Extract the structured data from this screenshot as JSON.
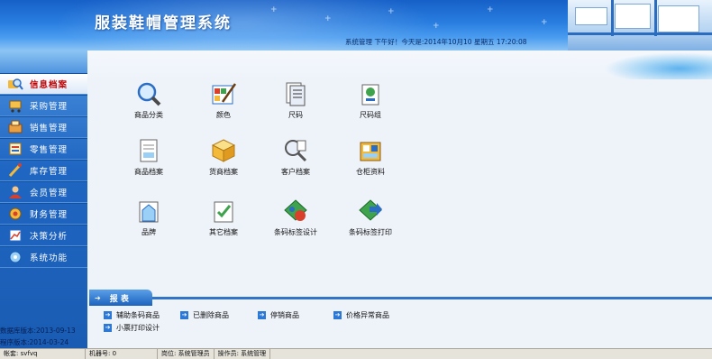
{
  "header": {
    "title": "服装鞋帽管理系统",
    "status": "系统管理  下午好！今天是:2014年10月10  星期五    17:20:08"
  },
  "sidebar": {
    "items": [
      {
        "label": "信息档案",
        "icon": "folder-search-icon",
        "active": true
      },
      {
        "label": "采购管理",
        "icon": "cart-icon",
        "active": false
      },
      {
        "label": "销售管理",
        "icon": "sale-icon",
        "active": false
      },
      {
        "label": "零售管理",
        "icon": "retail-icon",
        "active": false
      },
      {
        "label": "库存管理",
        "icon": "stock-icon",
        "active": false
      },
      {
        "label": "会员管理",
        "icon": "member-icon",
        "active": false
      },
      {
        "label": "财务管理",
        "icon": "finance-icon",
        "active": false
      },
      {
        "label": "决策分析",
        "icon": "analysis-icon",
        "active": false
      },
      {
        "label": "系统功能",
        "icon": "system-icon",
        "active": false
      }
    ],
    "db_version": "数据库版本:2013-09-13",
    "app_version": "程序版本:2014-03-24"
  },
  "tiles": [
    {
      "label": "商品分类",
      "icon": "magnifier-icon"
    },
    {
      "label": "颜色",
      "icon": "palette-icon"
    },
    {
      "label": "尺码",
      "icon": "ruler-doc-icon"
    },
    {
      "label": "尺码组",
      "icon": "size-group-icon"
    },
    {
      "label": "商品档案",
      "icon": "product-file-icon"
    },
    {
      "label": "货商档案",
      "icon": "supplier-box-icon"
    },
    {
      "label": "客户档案",
      "icon": "customer-search-icon"
    },
    {
      "label": "仓柜资料",
      "icon": "warehouse-icon"
    },
    {
      "label": "品牌",
      "icon": "brand-icon"
    },
    {
      "label": "其它档案",
      "icon": "other-file-icon"
    },
    {
      "label": "条码标签设计",
      "icon": "label-design-icon"
    },
    {
      "label": "条码标签打印",
      "icon": "label-print-icon"
    }
  ],
  "reports": {
    "tab_label": "报 表",
    "links": [
      {
        "label": "辅助条码商品"
      },
      {
        "label": "已删除商品"
      },
      {
        "label": "停销商品"
      },
      {
        "label": "价格异常商品"
      },
      {
        "label": "小票打印设计"
      }
    ]
  },
  "statusbar": {
    "cells": [
      "帐套: svfvq",
      "机器号: 0",
      "岗位: 系统管理员",
      "操作员: 系统管理"
    ]
  },
  "colors": {
    "header_blue": "#2a7ee0",
    "sidebar_blue": "#1f66c2",
    "active_label": "#c00000",
    "content_bg": "#eef3fa"
  }
}
